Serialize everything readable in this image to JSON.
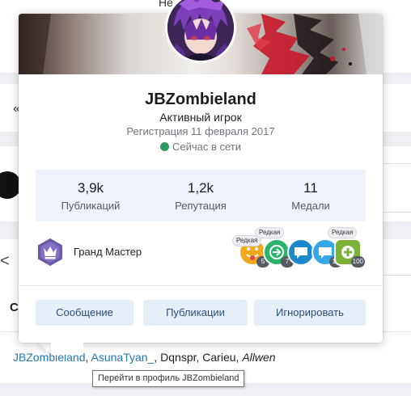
{
  "background": {
    "top_text": "Не",
    "guillemet": "«",
    "chevron": "<",
    "heading_initial": "С",
    "viewers": [
      "JBZombieland",
      "AsunaTyan_",
      "Dqnspr",
      "Carieu",
      "Allwen"
    ],
    "separator": ", ",
    "tooltip": "Перейти в профиль JBZombieland"
  },
  "card": {
    "username": "JBZombieland",
    "user_title": "Активный игрок",
    "registration": "Регистрация 11 февраля 2017",
    "online_status": "Сейчас в сети",
    "online_color": "#2e9a62",
    "stats": [
      {
        "value": "3,9k",
        "label": "Публикаций"
      },
      {
        "value": "1,2k",
        "label": "Репутация"
      },
      {
        "value": "11",
        "label": "Медали"
      }
    ],
    "rank": {
      "label": "Гранд Мастер",
      "icon": "crown-icon"
    },
    "trophies": [
      {
        "icon": "tongue-emoji-icon",
        "count": "5",
        "color": "#f2a81d"
      },
      {
        "icon": "enter-arrow-icon",
        "count": "7",
        "color": "#2bb36b"
      },
      {
        "icon": "chat-bubble-icon",
        "count": "",
        "color": "#1a88c9"
      },
      {
        "icon": "chat-bubble-icon",
        "count": "10",
        "color": "#36a8e8"
      },
      {
        "icon": "plus-badge-icon",
        "count": "100",
        "color": "#7bb33a"
      }
    ],
    "rare_label": "Редкая",
    "buttons": {
      "message": "Сообщение",
      "posts": "Публикации",
      "ignore": "Игнорировать"
    },
    "accent_color": "#2577b1"
  }
}
